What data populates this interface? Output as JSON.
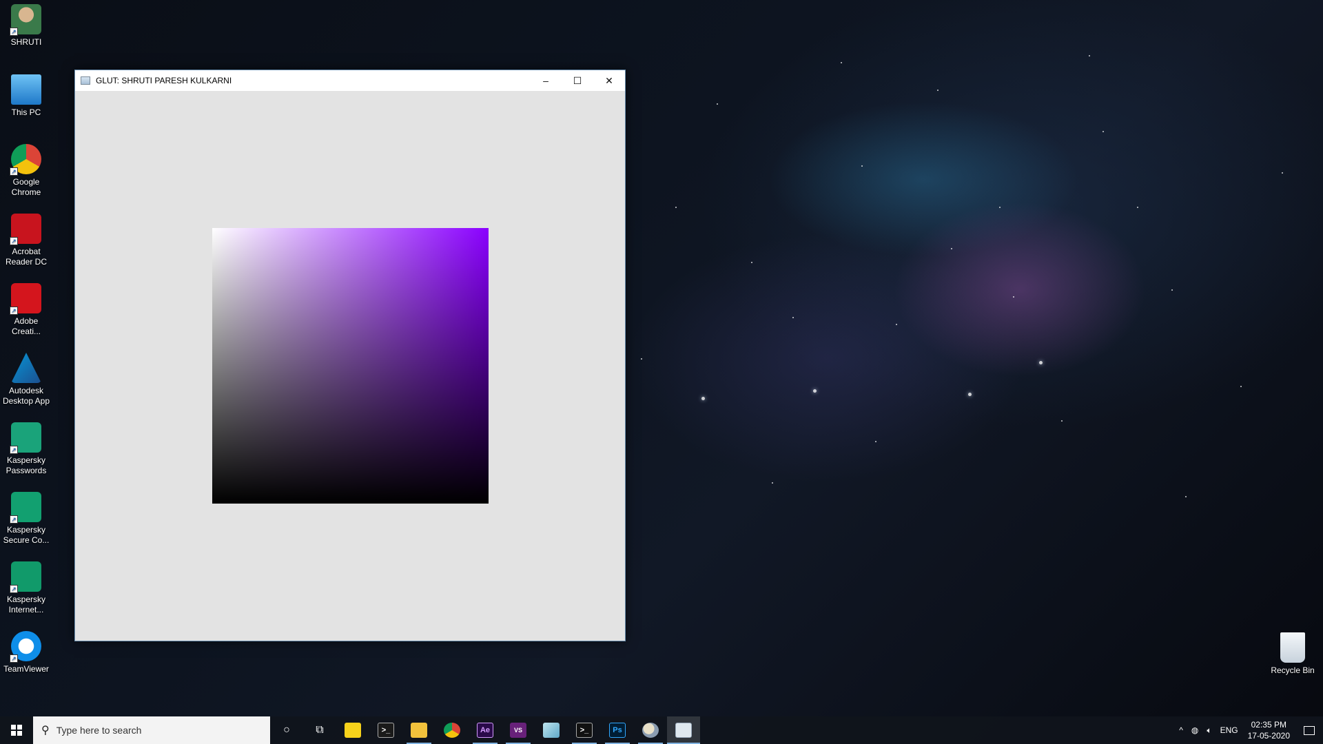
{
  "desktop": {
    "icons": [
      {
        "label": "SHRUTI"
      },
      {
        "label": "This PC"
      },
      {
        "label": "Google Chrome"
      },
      {
        "label": "Acrobat Reader DC"
      },
      {
        "label": "Adobe Creati..."
      },
      {
        "label": "Autodesk Desktop App"
      },
      {
        "label": "Kaspersky Passwords"
      },
      {
        "label": "Kaspersky Secure Co..."
      },
      {
        "label": "Kaspersky Internet..."
      },
      {
        "label": "TeamViewer"
      }
    ],
    "recycle_bin": "Recycle Bin"
  },
  "window": {
    "title": "GLUT: SHRUTI PARESH KULKARNI",
    "minimize": "–",
    "maximize": "☐",
    "close": "✕",
    "canvas_bg": "#e3e3e3",
    "gradient_colors": {
      "top_left": "#ffffff",
      "top_right": "#8a00ff",
      "bottom": "#000000"
    }
  },
  "taskbar": {
    "search_placeholder": "Type here to search",
    "apps": [
      {
        "name": "cortana-icon",
        "glyph": "○"
      },
      {
        "name": "task-view-icon",
        "glyph": "⧉"
      },
      {
        "name": "sticky-notes-icon",
        "glyph": ""
      },
      {
        "name": "terminal-icon",
        "glyph": ">_"
      },
      {
        "name": "file-explorer-icon",
        "glyph": ""
      },
      {
        "name": "chrome-icon",
        "glyph": ""
      },
      {
        "name": "after-effects-icon",
        "glyph": "Ae"
      },
      {
        "name": "visual-studio-icon",
        "glyph": "VS"
      },
      {
        "name": "app-icon",
        "glyph": ""
      },
      {
        "name": "console-icon",
        "glyph": ">_"
      },
      {
        "name": "photoshop-icon",
        "glyph": "Ps"
      },
      {
        "name": "paint-icon",
        "glyph": ""
      },
      {
        "name": "glut-window-icon",
        "glyph": ""
      }
    ],
    "tray": {
      "chevron": "^",
      "language": "ENG",
      "time": "02:35 PM",
      "date": "17-05-2020"
    }
  }
}
